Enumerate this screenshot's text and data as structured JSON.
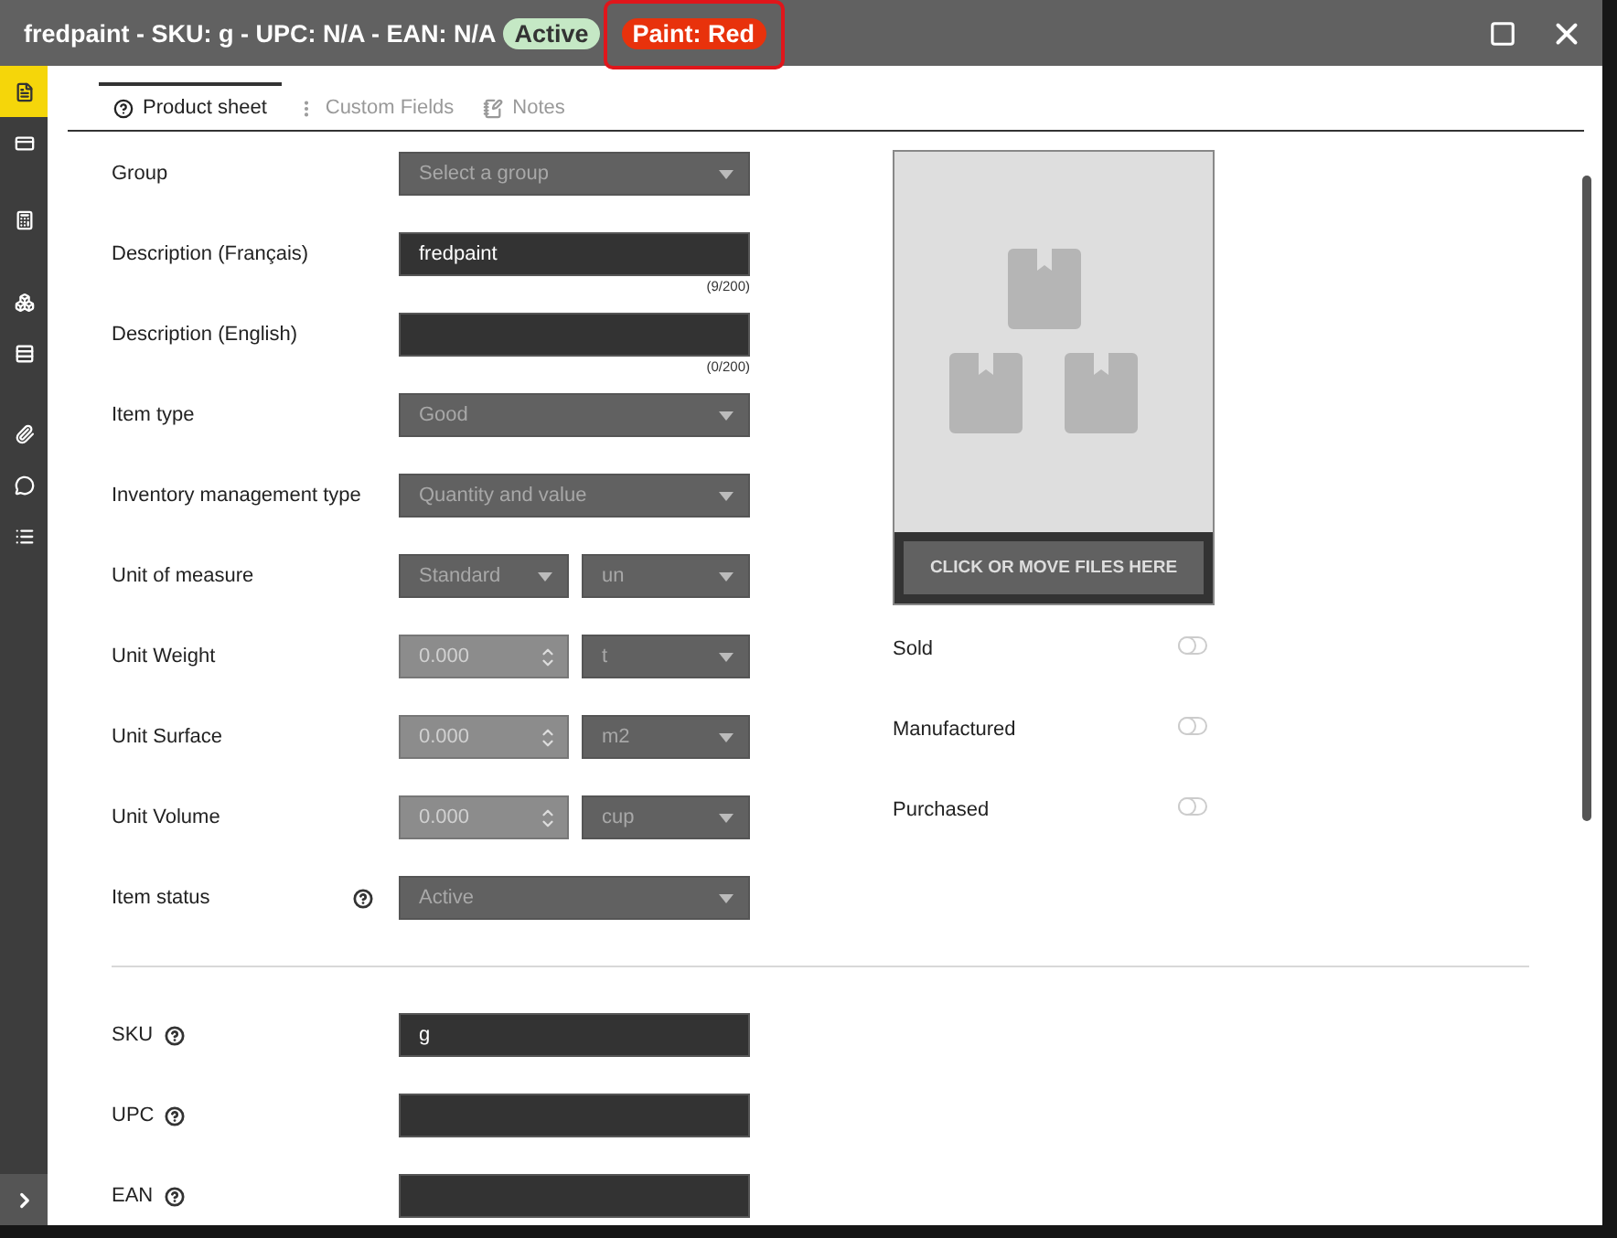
{
  "window": {
    "title": "fredpaint - SKU: g - UPC: N/A - EAN: N/A",
    "badges": [
      {
        "label": "Active",
        "color": "#c5e8c5",
        "highlighted": false
      },
      {
        "label": "Paint: Red",
        "color": "#e8320c",
        "highlighted": true
      }
    ]
  },
  "sidebar": {
    "items": [
      {
        "selected": true
      },
      {
        "selected": false
      },
      {
        "selected": false
      },
      {
        "selected": false
      },
      {
        "selected": false
      },
      {
        "selected": false
      },
      {
        "selected": false
      },
      {
        "selected": false
      }
    ]
  },
  "tabs": [
    {
      "label": "Product sheet",
      "selected": true
    },
    {
      "label": "Custom Fields",
      "selected": false
    },
    {
      "label": "Notes",
      "selected": false
    }
  ],
  "form": [
    {
      "kind": "select",
      "label": "Group",
      "placeholder": "Select a group"
    },
    {
      "kind": "text",
      "label": "Description (Français)",
      "value": "fredpaint",
      "counter": "(9/200)"
    },
    {
      "kind": "text",
      "label": "Description (English)",
      "counter": "(0/200)"
    },
    {
      "kind": "select",
      "label": "Item type",
      "value": "Good"
    },
    {
      "kind": "select",
      "label": "Inventory management type",
      "value": "Quantity and value"
    },
    {
      "kind": "select-pair",
      "label": "Unit of measure",
      "value": "Standard",
      "unit": "un"
    },
    {
      "kind": "number-unit",
      "label": "Unit Weight",
      "value": "0.000",
      "unit": "t"
    },
    {
      "kind": "number-unit",
      "label": "Unit Surface",
      "value": "0.000",
      "unit": "m2"
    },
    {
      "kind": "number-unit",
      "label": "Unit Volume",
      "value": "0.000",
      "unit": "cup"
    },
    {
      "kind": "select",
      "label": "Item status",
      "value": "Active",
      "help": true
    }
  ],
  "codes": [
    {
      "label": "SKU",
      "value": "g",
      "help": true
    },
    {
      "label": "UPC",
      "help": true
    },
    {
      "label": "EAN",
      "help": true
    }
  ],
  "upload": {
    "button": "CLICK OR MOVE FILES HERE"
  },
  "toggles": [
    {
      "label": "Sold",
      "on": false
    },
    {
      "label": "Manufactured",
      "on": false
    },
    {
      "label": "Purchased",
      "on": false
    }
  ]
}
